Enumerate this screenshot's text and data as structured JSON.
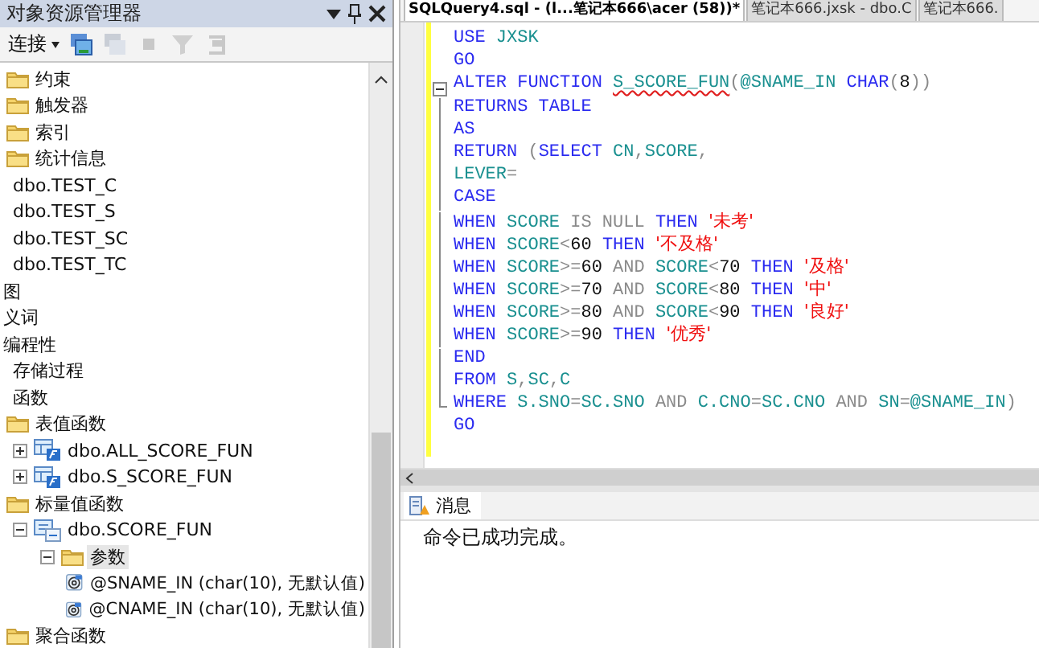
{
  "explorer": {
    "title": "对象资源管理器",
    "connect": "连接",
    "tree": [
      {
        "label": "约束",
        "kind": "folder"
      },
      {
        "label": "触发器",
        "kind": "folder"
      },
      {
        "label": "索引",
        "kind": "folder"
      },
      {
        "label": "统计信息",
        "kind": "folder"
      },
      {
        "label": "dbo.TEST_C",
        "kind": "text"
      },
      {
        "label": "dbo.TEST_S",
        "kind": "text"
      },
      {
        "label": "dbo.TEST_SC",
        "kind": "text"
      },
      {
        "label": "dbo.TEST_TC",
        "kind": "text"
      },
      {
        "label": "图",
        "kind": "clipped"
      },
      {
        "label": "义词",
        "kind": "clipped"
      },
      {
        "label": "编程性",
        "kind": "clipped",
        "children": [
          {
            "label": "存储过程",
            "kind": "text"
          },
          {
            "label": "函数",
            "kind": "text",
            "children": [
              {
                "label": "表值函数",
                "kind": "folder",
                "children": [
                  {
                    "label": "dbo.ALL_SCORE_FUN",
                    "kind": "function",
                    "expanded": false
                  },
                  {
                    "label": "dbo.S_SCORE_FUN",
                    "kind": "function",
                    "expanded": false
                  }
                ]
              },
              {
                "label": "标量值函数",
                "kind": "folder",
                "children": [
                  {
                    "label": "dbo.SCORE_FUN",
                    "kind": "scalar",
                    "expanded": true,
                    "children": [
                      {
                        "label": "参数",
                        "kind": "folder",
                        "expanded": true,
                        "selected": true,
                        "children": [
                          {
                            "label": "@SNAME_IN (char(10), 无默认值)",
                            "kind": "parameter"
                          },
                          {
                            "label": "@CNAME_IN (char(10), 无默认值)",
                            "kind": "parameter"
                          }
                        ]
                      }
                    ]
                  }
                ]
              },
              {
                "label": "聚合函数",
                "kind": "folder"
              }
            ]
          }
        ]
      }
    ]
  },
  "editor": {
    "tabs": [
      {
        "label": "SQLQuery4.sql - (l...笔记本666\\acer (58))*",
        "selected": true
      },
      {
        "label": "笔记本666.jxsk - dbo.C",
        "selected": false
      },
      {
        "label": "笔记本666.",
        "selected": false
      }
    ],
    "lines": [
      {
        "tokens": [
          {
            "text": "USE ",
            "kind": "keyword"
          },
          {
            "text": "JXSK",
            "kind": "ident"
          }
        ]
      },
      {
        "tokens": [
          {
            "text": "GO",
            "kind": "keyword"
          }
        ]
      },
      {
        "kind": "fold_start",
        "tokens": [
          {
            "text": "ALTER FUNCTION ",
            "kind": "keyword"
          },
          {
            "text": "S_SCORE_FUN",
            "kind": "error"
          },
          {
            "text": "(",
            "kind": "operator"
          },
          {
            "text": "@SNAME_IN ",
            "kind": "ident"
          },
          {
            "text": "CHAR",
            "kind": "keyword"
          },
          {
            "text": "(",
            "kind": "operator"
          },
          {
            "text": "8",
            "kind": "number"
          },
          {
            "text": "))",
            "kind": "operator"
          }
        ]
      },
      {
        "tokens": [
          {
            "text": "RETURNS TABLE",
            "kind": "keyword"
          }
        ]
      },
      {
        "tokens": [
          {
            "text": "AS",
            "kind": "keyword"
          }
        ]
      },
      {
        "tokens": [
          {
            "text": "RETURN ",
            "kind": "keyword"
          },
          {
            "text": "(",
            "kind": "operator"
          },
          {
            "text": "SELECT ",
            "kind": "keyword"
          },
          {
            "text": "CN",
            "kind": "ident"
          },
          {
            "text": ",",
            "kind": "operator"
          },
          {
            "text": "SCORE",
            "kind": "ident"
          },
          {
            "text": ",",
            "kind": "operator"
          }
        ]
      },
      {
        "tokens": [
          {
            "text": "LEVER",
            "kind": "ident"
          },
          {
            "text": "=",
            "kind": "operator"
          }
        ]
      },
      {
        "tokens": [
          {
            "text": "CASE",
            "kind": "keyword"
          }
        ]
      },
      {
        "tokens": [
          {
            "text": "WHEN ",
            "kind": "keyword"
          },
          {
            "text": "SCORE ",
            "kind": "ident"
          },
          {
            "text": "IS NULL ",
            "kind": "operator"
          },
          {
            "text": "THEN ",
            "kind": "keyword"
          },
          {
            "text": "'未考'",
            "kind": "string"
          }
        ]
      },
      {
        "tokens": [
          {
            "text": "WHEN ",
            "kind": "keyword"
          },
          {
            "text": "SCORE",
            "kind": "ident"
          },
          {
            "text": "<",
            "kind": "operator"
          },
          {
            "text": "60 ",
            "kind": "number"
          },
          {
            "text": "THEN ",
            "kind": "keyword"
          },
          {
            "text": "'不及格'",
            "kind": "string"
          }
        ]
      },
      {
        "tokens": [
          {
            "text": "WHEN ",
            "kind": "keyword"
          },
          {
            "text": "SCORE",
            "kind": "ident"
          },
          {
            "text": ">=",
            "kind": "operator"
          },
          {
            "text": "60 ",
            "kind": "number"
          },
          {
            "text": "AND ",
            "kind": "operator"
          },
          {
            "text": "SCORE",
            "kind": "ident"
          },
          {
            "text": "<",
            "kind": "operator"
          },
          {
            "text": "70 ",
            "kind": "number"
          },
          {
            "text": "THEN ",
            "kind": "keyword"
          },
          {
            "text": "'及格'",
            "kind": "string"
          }
        ]
      },
      {
        "tokens": [
          {
            "text": "WHEN ",
            "kind": "keyword"
          },
          {
            "text": "SCORE",
            "kind": "ident"
          },
          {
            "text": ">=",
            "kind": "operator"
          },
          {
            "text": "70 ",
            "kind": "number"
          },
          {
            "text": "AND ",
            "kind": "operator"
          },
          {
            "text": "SCORE",
            "kind": "ident"
          },
          {
            "text": "<",
            "kind": "operator"
          },
          {
            "text": "80 ",
            "kind": "number"
          },
          {
            "text": "THEN ",
            "kind": "keyword"
          },
          {
            "text": "'中'",
            "kind": "string"
          }
        ]
      },
      {
        "tokens": [
          {
            "text": "WHEN ",
            "kind": "keyword"
          },
          {
            "text": "SCORE",
            "kind": "ident"
          },
          {
            "text": ">=",
            "kind": "operator"
          },
          {
            "text": "80 ",
            "kind": "number"
          },
          {
            "text": "AND ",
            "kind": "operator"
          },
          {
            "text": "SCORE",
            "kind": "ident"
          },
          {
            "text": "<",
            "kind": "operator"
          },
          {
            "text": "90 ",
            "kind": "number"
          },
          {
            "text": "THEN ",
            "kind": "keyword"
          },
          {
            "text": "'良好'",
            "kind": "string"
          }
        ]
      },
      {
        "tokens": [
          {
            "text": "WHEN ",
            "kind": "keyword"
          },
          {
            "text": "SCORE",
            "kind": "ident"
          },
          {
            "text": ">=",
            "kind": "operator"
          },
          {
            "text": "90 ",
            "kind": "number"
          },
          {
            "text": "THEN ",
            "kind": "keyword"
          },
          {
            "text": "'优秀'",
            "kind": "string"
          }
        ]
      },
      {
        "tokens": [
          {
            "text": "END",
            "kind": "keyword"
          }
        ]
      },
      {
        "tokens": [
          {
            "text": "FROM ",
            "kind": "keyword"
          },
          {
            "text": "S",
            "kind": "ident"
          },
          {
            "text": ",",
            "kind": "operator"
          },
          {
            "text": "SC",
            "kind": "ident"
          },
          {
            "text": ",",
            "kind": "operator"
          },
          {
            "text": "C",
            "kind": "ident"
          }
        ]
      },
      {
        "kind": "fold_end",
        "tokens": [
          {
            "text": "WHERE ",
            "kind": "keyword"
          },
          {
            "text": "S.SNO",
            "kind": "ident"
          },
          {
            "text": "=",
            "kind": "operator"
          },
          {
            "text": "SC.SNO ",
            "kind": "ident"
          },
          {
            "text": "AND ",
            "kind": "operator"
          },
          {
            "text": "C.CNO",
            "kind": "ident"
          },
          {
            "text": "=",
            "kind": "operator"
          },
          {
            "text": "SC.CNO ",
            "kind": "ident"
          },
          {
            "text": "AND ",
            "kind": "operator"
          },
          {
            "text": "SN",
            "kind": "ident"
          },
          {
            "text": "=",
            "kind": "operator"
          },
          {
            "text": "@SNAME_IN",
            "kind": "ident"
          },
          {
            "text": ")",
            "kind": "operator"
          }
        ]
      },
      {
        "tokens": [
          {
            "text": "GO",
            "kind": "keyword"
          }
        ]
      }
    ]
  },
  "messages": {
    "tab": "消息",
    "text": "命令已成功完成。"
  }
}
